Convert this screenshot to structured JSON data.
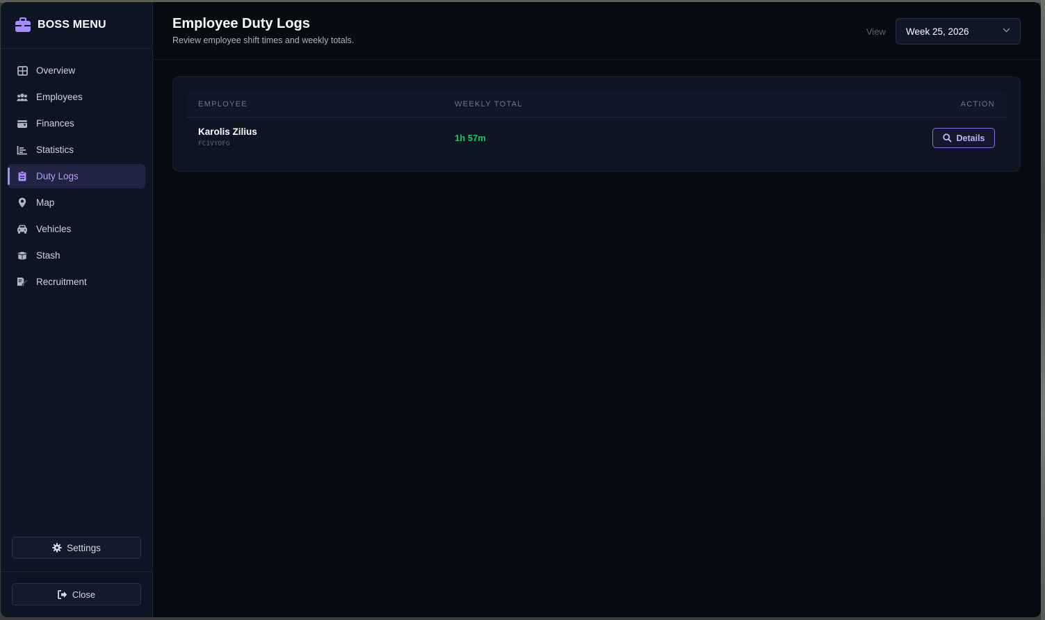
{
  "brand": {
    "title": "BOSS MENU",
    "icon": "briefcase-icon"
  },
  "nav": {
    "items": [
      {
        "label": "Overview",
        "icon": "grid-icon"
      },
      {
        "label": "Employees",
        "icon": "users-icon"
      },
      {
        "label": "Finances",
        "icon": "wallet-icon"
      },
      {
        "label": "Statistics",
        "icon": "chart-icon"
      },
      {
        "label": "Duty Logs",
        "icon": "clipboard-icon"
      },
      {
        "label": "Map",
        "icon": "map-pin-icon"
      },
      {
        "label": "Vehicles",
        "icon": "car-icon"
      },
      {
        "label": "Stash",
        "icon": "box-icon"
      },
      {
        "label": "Recruitment",
        "icon": "signature-icon"
      }
    ],
    "active": "Duty Logs"
  },
  "footer": {
    "settings_label": "Settings",
    "close_label": "Close"
  },
  "header": {
    "title": "Employee Duty Logs",
    "subtitle": "Review employee shift times and weekly totals.",
    "view_label": "View",
    "week_selected": "Week 25, 2026"
  },
  "table": {
    "columns": {
      "employee": "EMPLOYEE",
      "weekly_total": "WEEKLY TOTAL",
      "action": "ACTION"
    },
    "rows": [
      {
        "name": "Karolis Zilius",
        "id": "FC1VYOFG",
        "weekly_total": "1h 57m",
        "action_label": "Details"
      }
    ]
  },
  "colors": {
    "accent": "#a78bfa",
    "success": "#22c55e",
    "background": "#070b12",
    "sidebar": "#0c1524"
  }
}
